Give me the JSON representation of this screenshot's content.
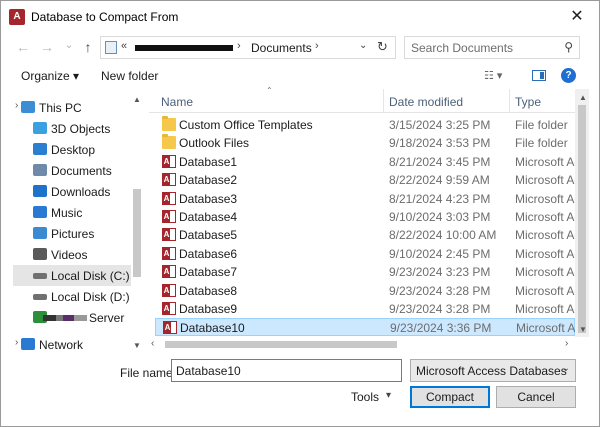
{
  "window": {
    "title": "Database to Compact From",
    "close_glyph": "✕"
  },
  "nav": {
    "back": "←",
    "forward": "→",
    "recent": "⌄",
    "up": "↑",
    "address_chevron": "«",
    "address_path": [
      "Documents"
    ],
    "search_placeholder": "Search Documents"
  },
  "toolbar": {
    "organize": "Organize ▾",
    "new_folder": "New folder",
    "view_glyph": "☷ ▾",
    "help": "?"
  },
  "sidebar": {
    "items": [
      {
        "label": "This PC",
        "icon": "pc-icon",
        "color": "#3b8ed6"
      },
      {
        "label": "3D Objects",
        "icon": "cube-icon",
        "color": "#3ba0e0"
      },
      {
        "label": "Desktop",
        "icon": "desktop-icon",
        "color": "#2c7fd0"
      },
      {
        "label": "Documents",
        "icon": "document-icon",
        "color": "#6e8aa8"
      },
      {
        "label": "Downloads",
        "icon": "download-icon",
        "color": "#1d73c9"
      },
      {
        "label": "Music",
        "icon": "music-icon",
        "color": "#2a7ad3"
      },
      {
        "label": "Pictures",
        "icon": "pictures-icon",
        "color": "#3a8bd0"
      },
      {
        "label": "Videos",
        "icon": "video-icon",
        "color": "#5a5a5a"
      },
      {
        "label": "Local Disk (C:)",
        "icon": "drive-icon",
        "color": "#707070"
      },
      {
        "label": "Local Disk (D:)",
        "icon": "drive-icon",
        "color": "#707070"
      },
      {
        "label": "Server",
        "icon": "network-drive-icon",
        "color": "#2d8f3a"
      },
      {
        "label": "Network",
        "icon": "network-icon",
        "color": "#2a7ad3"
      }
    ]
  },
  "columns": {
    "name": "Name",
    "date": "Date modified",
    "type": "Type"
  },
  "files": [
    {
      "name": "Custom Office Templates",
      "date": "3/15/2024 3:25 PM",
      "type": "File folder",
      "kind": "folder"
    },
    {
      "name": "Outlook Files",
      "date": "9/18/2024 3:53 PM",
      "type": "File folder",
      "kind": "folder"
    },
    {
      "name": "Database1",
      "date": "8/21/2024 3:45 PM",
      "type": "Microsoft Acc",
      "kind": "access"
    },
    {
      "name": "Database2",
      "date": "8/22/2024 9:59 AM",
      "type": "Microsoft Acc",
      "kind": "access"
    },
    {
      "name": "Database3",
      "date": "8/21/2024 4:23 PM",
      "type": "Microsoft Acc",
      "kind": "access"
    },
    {
      "name": "Database4",
      "date": "9/10/2024 3:03 PM",
      "type": "Microsoft Acc",
      "kind": "access"
    },
    {
      "name": "Database5",
      "date": "8/22/2024 10:00 AM",
      "type": "Microsoft Acc",
      "kind": "access"
    },
    {
      "name": "Database6",
      "date": "9/10/2024 2:45 PM",
      "type": "Microsoft Acc",
      "kind": "access"
    },
    {
      "name": "Database7",
      "date": "9/23/2024 3:23 PM",
      "type": "Microsoft Acc",
      "kind": "access"
    },
    {
      "name": "Database8",
      "date": "9/23/2024 3:28 PM",
      "type": "Microsoft Acc",
      "kind": "access"
    },
    {
      "name": "Database9",
      "date": "9/23/2024 3:28 PM",
      "type": "Microsoft Acc",
      "kind": "access"
    },
    {
      "name": "Database10",
      "date": "9/23/2024 3:36 PM",
      "type": "Microsoft Acc",
      "kind": "access",
      "selected": true
    }
  ],
  "bottom": {
    "file_name_label": "File name:",
    "file_name_value": "Database10",
    "filter": "Microsoft Access Databases",
    "tools": "Tools",
    "compact": "Compact",
    "cancel": "Cancel"
  },
  "colors": {
    "accent": "#0078d7",
    "selection": "#cce8ff",
    "access_red": "#a4262c"
  }
}
